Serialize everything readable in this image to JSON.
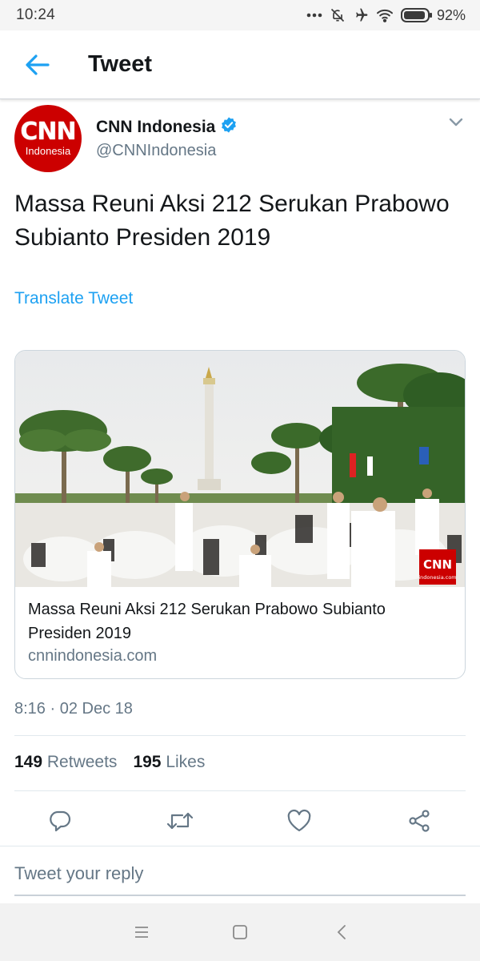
{
  "status_bar": {
    "time": "10:24",
    "battery_percent": "92%",
    "battery_level": 0.92,
    "icons": [
      "more-dots-icon",
      "notifications-off-icon",
      "airplane-icon",
      "wifi-icon",
      "battery-icon"
    ]
  },
  "header": {
    "title": "Tweet",
    "back_icon": "arrow-left-icon"
  },
  "tweet": {
    "author_name": "CNN Indonesia",
    "author_handle": "@CNNIndonesia",
    "verified": true,
    "avatar": {
      "logo": "CNN",
      "sub": "Indonesia"
    },
    "text": "Massa Reuni Aksi 212 Serukan Prabowo Subianto Presiden 2019",
    "translate_label": "Translate Tweet",
    "card": {
      "title": "Massa Reuni Aksi 212 Serukan Prabowo Subianto Presiden 2019",
      "domain": "cnnindonesia.com",
      "watermark_logo": "CNN",
      "watermark_sub": "indonesia.com"
    },
    "timestamp": "8:16 · 02 Dec 18",
    "retweets_count": "149",
    "retweets_label": "Retweets",
    "likes_count": "195",
    "likes_label": "Likes"
  },
  "actions": [
    "reply-icon",
    "retweet-icon",
    "like-icon",
    "share-icon"
  ],
  "reply": {
    "placeholder": "Tweet your reply"
  },
  "nav": [
    "menu-icon",
    "home-icon",
    "back-icon"
  ],
  "colors": {
    "accent": "#1da1f2",
    "cnn_red": "#cc0000",
    "secondary_text": "#657786"
  }
}
